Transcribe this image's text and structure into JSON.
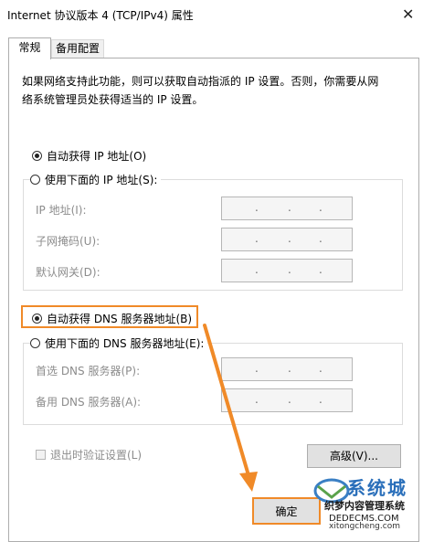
{
  "window": {
    "title": "Internet 协议版本 4 (TCP/IPv4) 属性"
  },
  "tabs": [
    {
      "label": "常规"
    },
    {
      "label": "备用配置"
    }
  ],
  "description": [
    "如果网络支持此功能，则可以获取自动指派的 IP 设置。否则，你需要从网",
    "络系统管理员处获得适当的 IP 设置。"
  ],
  "ip": {
    "auto_label": "自动获得 IP 地址(O)",
    "manual_label": "使用下面的 IP 地址(S):",
    "fields": [
      {
        "label": "IP 地址(I):"
      },
      {
        "label": "子网掩码(U):"
      },
      {
        "label": "默认网关(D):"
      }
    ]
  },
  "dns": {
    "auto_label": "自动获得 DNS 服务器地址(B)",
    "manual_label": "使用下面的 DNS 服务器地址(E):",
    "fields": [
      {
        "label": "首选 DNS 服务器(P):"
      },
      {
        "label": "备用 DNS 服务器(A):"
      }
    ]
  },
  "validate_label": "退出时验证设置(L)",
  "buttons": {
    "advanced": "高级(V)...",
    "ok": "确定"
  },
  "watermark": {
    "logo": "系统城",
    "line1": "织梦内容管理系统",
    "line2": "DEDECMS.COM",
    "url": "xitongcheng.com"
  },
  "colors": {
    "highlight": "#f08a28"
  }
}
